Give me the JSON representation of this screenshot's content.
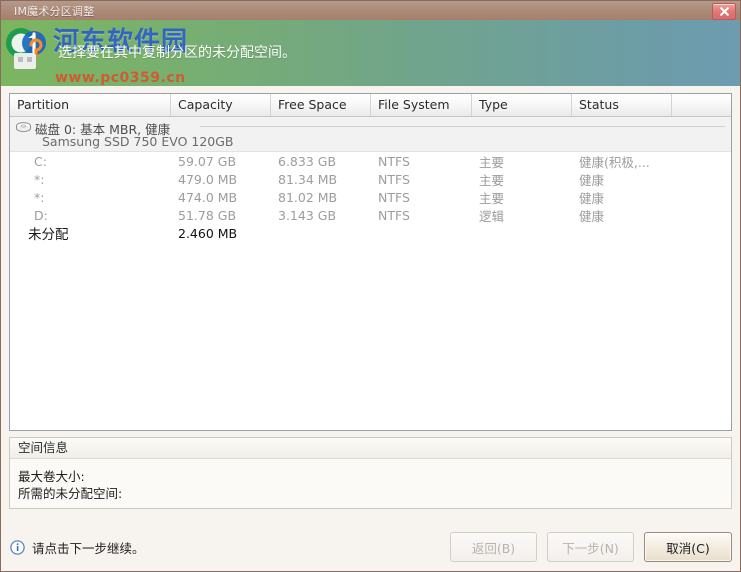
{
  "window": {
    "title": "IM魔术分区调整",
    "close_icon": "close-icon"
  },
  "banner": {
    "text": "选择要在其中复制分区的未分配空间。",
    "watermark_title": "河东软件园",
    "watermark_url": "www.pc0359.cn"
  },
  "table": {
    "columns": [
      {
        "key": "partition",
        "label": "Partition"
      },
      {
        "key": "capacity",
        "label": "Capacity"
      },
      {
        "key": "free_space",
        "label": "Free Space"
      },
      {
        "key": "file_system",
        "label": "File System"
      },
      {
        "key": "type",
        "label": "Type"
      },
      {
        "key": "status",
        "label": "Status"
      }
    ],
    "disk": {
      "icon": "disk-icon",
      "line1": "磁盘 0: 基本 MBR, 健康",
      "line2": "Samsung SSD 750 EVO 120GB"
    },
    "rows": [
      {
        "partition": "C:",
        "capacity": "59.07 GB",
        "free_space": "6.833 GB",
        "file_system": "NTFS",
        "type": "主要",
        "status": "健康(积极,...",
        "active": false
      },
      {
        "partition": "*:",
        "capacity": "479.0 MB",
        "free_space": "81.34 MB",
        "file_system": "NTFS",
        "type": "主要",
        "status": "健康",
        "active": false
      },
      {
        "partition": "*:",
        "capacity": "474.0 MB",
        "free_space": "81.02 MB",
        "file_system": "NTFS",
        "type": "主要",
        "status": "健康",
        "active": false
      },
      {
        "partition": "D:",
        "capacity": "51.78 GB",
        "free_space": "3.143 GB",
        "file_system": "NTFS",
        "type": "逻辑",
        "status": "健康",
        "active": false
      },
      {
        "partition": "未分配",
        "capacity": "2.460 MB",
        "free_space": "",
        "file_system": "",
        "type": "",
        "status": "",
        "active": true
      }
    ]
  },
  "space_info": {
    "group_title": "空间信息",
    "max_volume_label": "最大卷大小:",
    "max_volume_value": "",
    "required_unallocated_label": "所需的未分配空间:",
    "required_unallocated_value": ""
  },
  "footer": {
    "info_icon": "info-icon",
    "status_text": "请点击下一步继续。",
    "buttons": [
      {
        "name": "back-button",
        "label": "返回(B)",
        "accel": "B",
        "disabled": true,
        "default": false
      },
      {
        "name": "next-button",
        "label": "下一步(N)",
        "accel": "N",
        "disabled": true,
        "default": false
      },
      {
        "name": "cancel-button",
        "label": "取消(C)",
        "accel": "C",
        "disabled": false,
        "default": true
      }
    ]
  },
  "colors": {
    "titlebar": "#ab8977",
    "frame": "#b08d7d",
    "banner_start": "#7cb560",
    "banner_end": "#6d9bb0",
    "panel_bg": "#f7f4ef",
    "close_red": "#e07878",
    "watermark_blue": "#2f62c4",
    "watermark_orange": "#e04a28"
  }
}
